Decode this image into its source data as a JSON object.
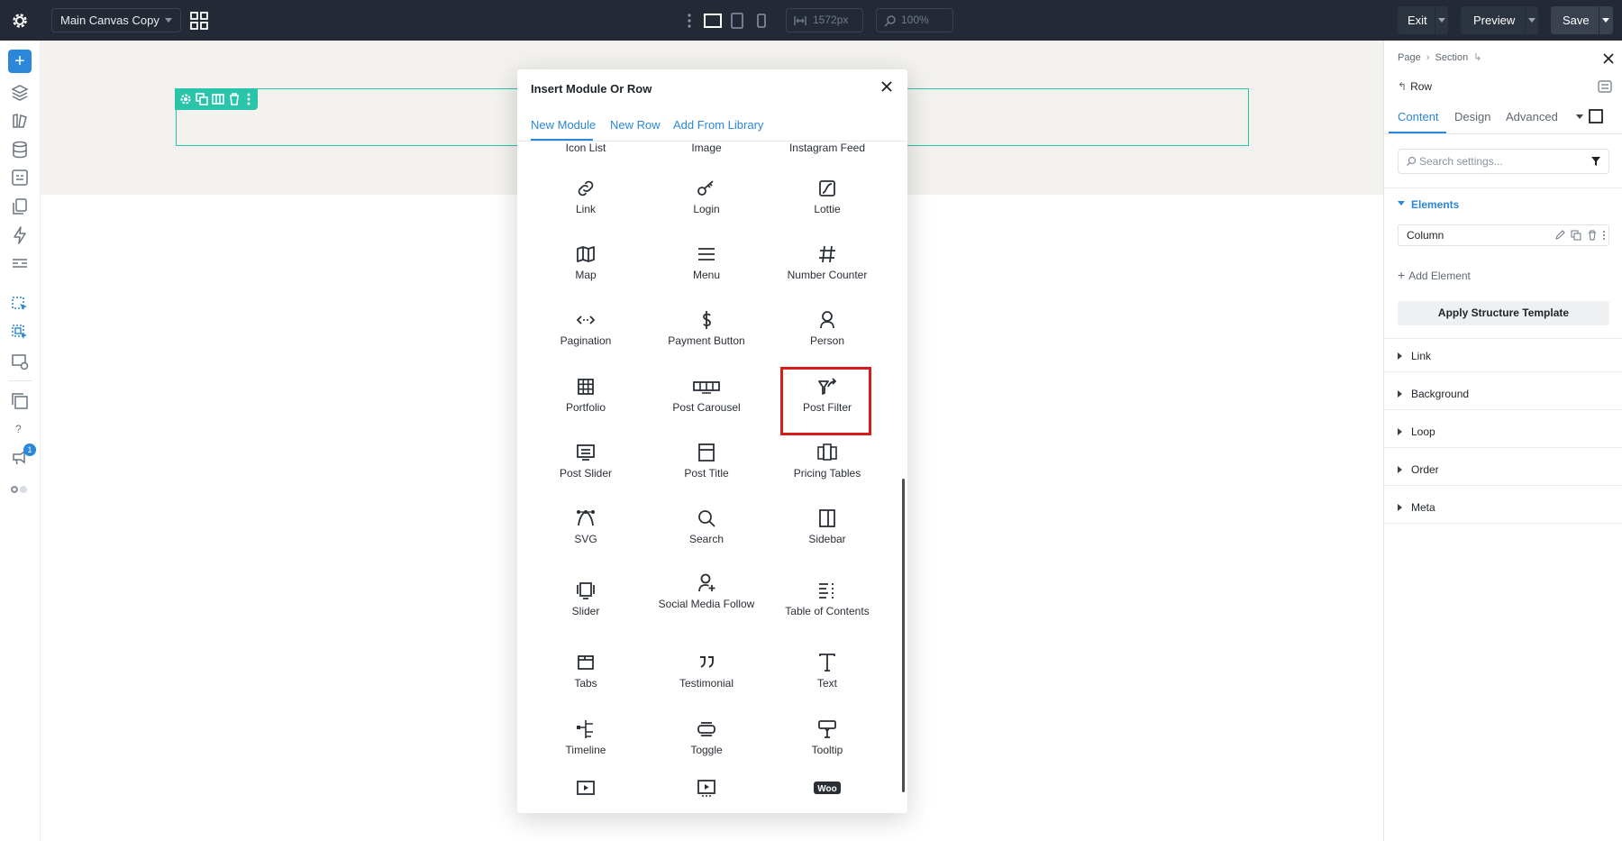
{
  "topbar": {
    "canvas_name": "Main Canvas Copy",
    "width_value": "1572px",
    "zoom_value": "100%",
    "exit_label": "Exit",
    "preview_label": "Preview",
    "save_label": "Save"
  },
  "leftbar": {
    "add_label": "+",
    "help_label": "?",
    "notification_count": "1"
  },
  "modal": {
    "title": "Insert Module Or Row",
    "tabs": [
      "New Module",
      "New Row",
      "Add From Library"
    ],
    "active_tab": "New Module",
    "highlighted_module": "Post Filter",
    "modules": [
      {
        "label": "Icon List",
        "icon": "icon-list-icon"
      },
      {
        "label": "Image",
        "icon": "image-icon"
      },
      {
        "label": "Instagram Feed",
        "icon": "instagram-icon"
      },
      {
        "label": "Link",
        "icon": "link-icon"
      },
      {
        "label": "Login",
        "icon": "key-icon"
      },
      {
        "label": "Lottie",
        "icon": "lottie-icon"
      },
      {
        "label": "Map",
        "icon": "map-icon"
      },
      {
        "label": "Menu",
        "icon": "menu-icon"
      },
      {
        "label": "Number Counter",
        "icon": "hash-icon"
      },
      {
        "label": "Pagination",
        "icon": "pagination-icon"
      },
      {
        "label": "Payment Button",
        "icon": "dollar-icon"
      },
      {
        "label": "Person",
        "icon": "person-icon"
      },
      {
        "label": "Portfolio",
        "icon": "grid-icon"
      },
      {
        "label": "Post Carousel",
        "icon": "carousel-icon"
      },
      {
        "label": "Post Filter",
        "icon": "filter-icon"
      },
      {
        "label": "Post Slider",
        "icon": "post-slider-icon"
      },
      {
        "label": "Post Title",
        "icon": "post-title-icon"
      },
      {
        "label": "Pricing Tables",
        "icon": "pricing-tables-icon"
      },
      {
        "label": "SVG",
        "icon": "svg-icon"
      },
      {
        "label": "Search",
        "icon": "search-icon"
      },
      {
        "label": "Sidebar",
        "icon": "sidebar-icon"
      },
      {
        "label": "Slider",
        "icon": "slider-icon"
      },
      {
        "label": "Social Media Follow",
        "icon": "social-follow-icon"
      },
      {
        "label": "Table of Contents",
        "icon": "table-of-contents-icon"
      },
      {
        "label": "Tabs",
        "icon": "tabs-icon"
      },
      {
        "label": "Testimonial",
        "icon": "quote-icon"
      },
      {
        "label": "Text",
        "icon": "text-icon"
      },
      {
        "label": "Timeline",
        "icon": "timeline-icon"
      },
      {
        "label": "Toggle",
        "icon": "toggle-icon"
      },
      {
        "label": "Tooltip",
        "icon": "tooltip-icon"
      },
      {
        "label": "",
        "icon": "video-icon"
      },
      {
        "label": "",
        "icon": "video-slider-icon"
      },
      {
        "label": "",
        "icon": "woo-icon"
      }
    ]
  },
  "right_panel": {
    "breadcrumb": [
      "Page",
      "Section"
    ],
    "element_name": "Row",
    "tabs": [
      "Content",
      "Design",
      "Advanced"
    ],
    "active_tab": "Content",
    "search_placeholder": "Search settings...",
    "elements_heading": "Elements",
    "column_label": "Column",
    "add_element_label": "Add Element",
    "apply_template_label": "Apply Structure Template",
    "sections": [
      "Link",
      "Background",
      "Loop",
      "Order",
      "Meta"
    ]
  },
  "colors": {
    "topbar": "#232a35",
    "accent_blue": "#2b87da",
    "row_green": "#29c4a9",
    "highlight_red": "#d71c1c",
    "canvas_bg": "#f3f2ef"
  }
}
